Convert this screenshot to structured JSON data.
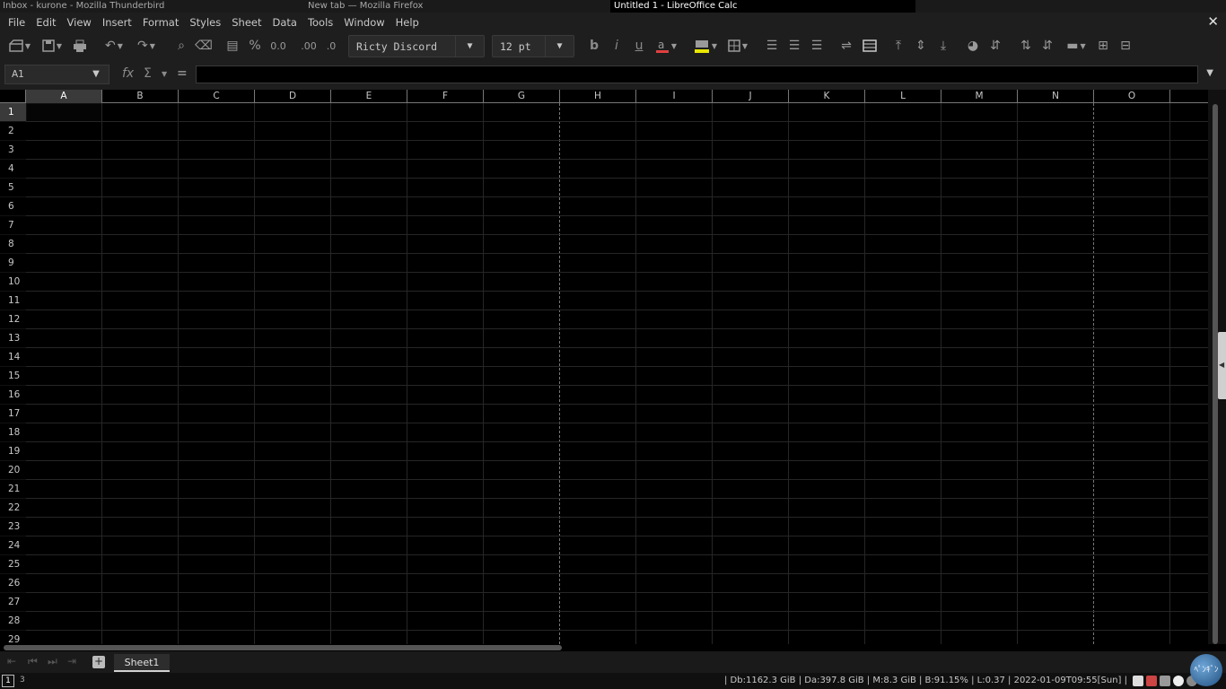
{
  "windows": {
    "thunderbird_title": "Inbox - kurone - Mozilla Thunderbird",
    "firefox_title": "New tab — Mozilla Firefox",
    "calc_title": "Untitled 1 - LibreOffice Calc"
  },
  "menu": [
    "File",
    "Edit",
    "View",
    "Insert",
    "Format",
    "Styles",
    "Sheet",
    "Data",
    "Tools",
    "Window",
    "Help"
  ],
  "close_doc_icon": "close-icon",
  "toolbar": {
    "font_name": "Ricty Discord",
    "font_size": "12 pt",
    "icons": [
      "new-icon",
      "save-icon",
      "print-icon",
      "undo-icon",
      "redo-icon",
      "find-icon",
      "clear-icon",
      "currency-icon",
      "percent-icon",
      "number-icon",
      "add-decimal-icon",
      "delete-decimal-icon",
      "bold-icon",
      "italic-icon",
      "underline-icon",
      "font-color-icon",
      "highlight-icon",
      "borders-icon",
      "align-left-icon",
      "align-center-icon",
      "align-right-icon",
      "wrap-icon",
      "merge-icon",
      "align-top-icon",
      "align-middle-icon",
      "align-bottom-icon",
      "conditional-icon",
      "autofilter-icon",
      "sort-asc-icon",
      "sort-desc-icon",
      "row-icon",
      "insert-row-icon",
      "delete-row-icon"
    ],
    "font_color": "#e04040",
    "highlight_color": "#e8e800"
  },
  "formula_bar": {
    "name_box": "A1",
    "formula": "",
    "fx_label": "fx",
    "sum_label": "Σ",
    "equals_label": "="
  },
  "grid": {
    "columns": [
      "A",
      "B",
      "C",
      "D",
      "E",
      "F",
      "G",
      "H",
      "I",
      "J",
      "K",
      "L",
      "M",
      "N",
      "O"
    ],
    "rows": [
      "1",
      "2",
      "3",
      "4",
      "5",
      "6",
      "7",
      "8",
      "9",
      "10",
      "11",
      "12",
      "13",
      "14",
      "15",
      "16",
      "17",
      "18",
      "19",
      "20",
      "21",
      "22",
      "23",
      "24",
      "25",
      "26",
      "27",
      "28",
      "29"
    ],
    "selected_column": "A",
    "selected_row": "1"
  },
  "sheets": {
    "tabs": [
      "Sheet1"
    ],
    "active": "Sheet1",
    "add_label": "+"
  },
  "statusbar": {
    "workspace": "1",
    "workspace_other": "3",
    "system_info": "| Db:1162.3 GiB | Da:397.8 GiB | M:8.3 GiB | B:91.15% | L:0.37 | 2022-01-09T09:55[Sun] |",
    "avatar_text": "ﾍﾟﾝｷﾞﾝ"
  }
}
